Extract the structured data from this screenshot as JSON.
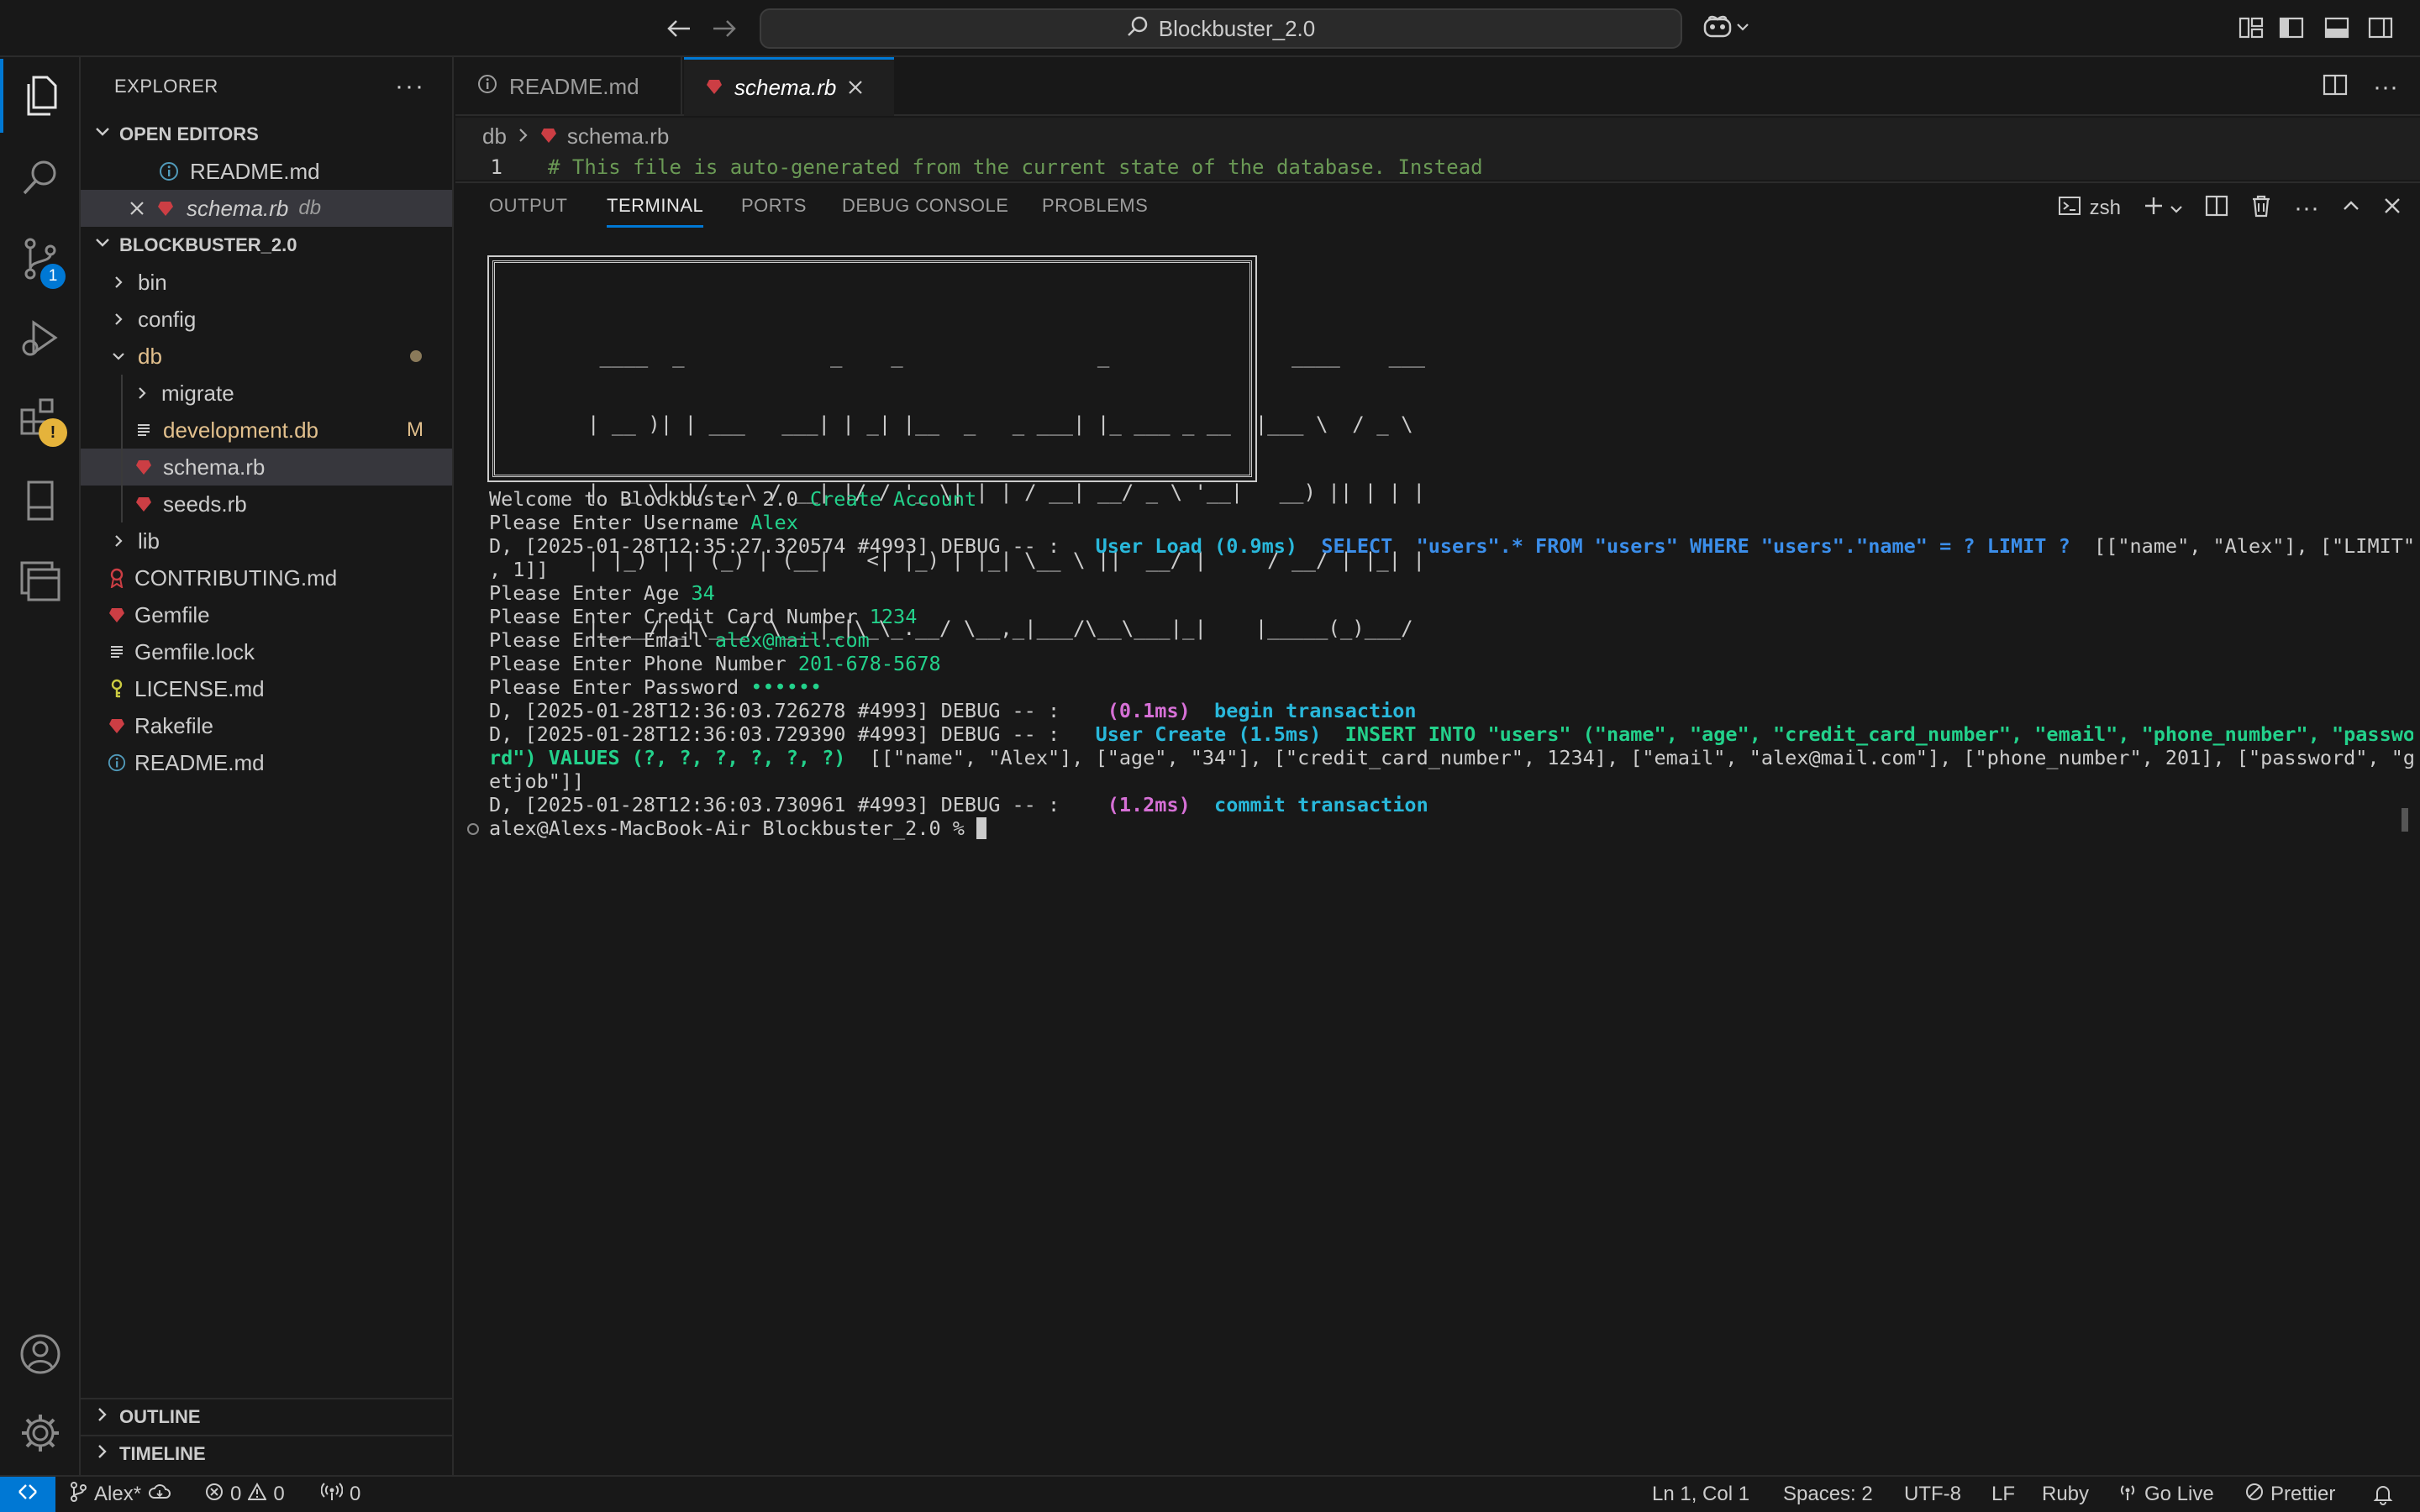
{
  "titlebar": {
    "search_text": "Blockbuster_2.0"
  },
  "activity": {
    "scm_badge": "1"
  },
  "sidebar": {
    "title": "EXPLORER",
    "open_editors_title": "OPEN EDITORS",
    "open_editors": [
      {
        "name": "README.md"
      },
      {
        "name": "schema.rb",
        "desc": "db"
      }
    ],
    "project_title": "BLOCKBUSTER_2.0",
    "tree": {
      "bin": "bin",
      "config": "config",
      "db": "db",
      "migrate": "migrate",
      "development_db": "development.db",
      "development_db_status": "M",
      "schema": "schema.rb",
      "seeds": "seeds.rb",
      "lib": "lib",
      "contributing": "CONTRIBUTING.md",
      "gemfile": "Gemfile",
      "gemfile_lock": "Gemfile.lock",
      "license": "LICENSE.md",
      "rakefile": "Rakefile",
      "readme": "README.md"
    },
    "outline": "OUTLINE",
    "timeline": "TIMELINE"
  },
  "editor": {
    "tabs": [
      {
        "label": "README.md"
      },
      {
        "label": "schema.rb"
      }
    ],
    "breadcrumb": [
      "db",
      "schema.rb"
    ],
    "line_number": "1",
    "line_text": "# This file is auto-generated from the current state of the database. Instead"
  },
  "panel": {
    "tabs": [
      "OUTPUT",
      "TERMINAL",
      "PORTS",
      "DEBUG CONSOLE",
      "PROBLEMS"
    ],
    "shell": "zsh"
  },
  "terminal": {
    "ascii_art": [
      " ____  _            _    _                _               ____    ___  ",
      "| __ )| | ___   ___| | _| |__  _   _ ___| |_ ___ _ __  |___ \\  / _ \\ ",
      "|  _ \\| |/ _ \\ / __| |/ / '_ \\| | | / __| __/ _ \\ '__|   __) || | | |",
      "| |_) | | (_) | (__|   <| |_) | |_| \\__ \\ ||  __/ |     / __/ | |_| |",
      "|____/|_|\\___/ \\___|_|\\_\\_.__/ \\__,_|___/\\__\\___|_|    |_____(_)___/ "
    ],
    "welcome": "Welcome to Blockbuster 2.0 ",
    "welcome_action": "Create Account",
    "username_prompt": "Please Enter Username ",
    "username_value": "Alex",
    "debug1_prefix": "D, [2025-01-28T12:35:27.320574 #4993] DEBUG -- :   ",
    "debug1_load": "User Load (0.9ms)",
    "debug1_sql": "  SELECT  \"users\".* FROM \"users\" WHERE \"users\".\"name\" = ? LIMIT ?",
    "debug1_binds": "  [[\"name\", \"Alex\"], [\"LIMIT\"",
    "debug1_wrap": ", 1]]",
    "age_prompt": "Please Enter Age ",
    "age_value": "34",
    "cc_prompt": "Please Enter Credit Card Number ",
    "cc_value": "1234",
    "email_prompt": "Please Enter Email ",
    "email_value": "alex@mail.com",
    "phone_prompt": "Please Enter Phone Number ",
    "phone_value": "201-678-5678",
    "password_prompt": "Please Enter Password ",
    "password_value": "••••••",
    "debug2_prefix": "D, [2025-01-28T12:36:03.726278 #4993] DEBUG -- :    ",
    "debug2_time": "(0.1ms)",
    "debug2_sql": "  begin transaction",
    "debug3_prefix": "D, [2025-01-28T12:36:03.729390 #4993] DEBUG -- :   ",
    "debug3_create": "User Create (1.5ms)",
    "debug3_sql": "  INSERT INTO \"users\" (\"name\", \"age\", \"credit_card_number\", \"email\", \"phone_number\", \"passwo",
    "debug3_sql_wrap": "rd\") VALUES (?, ?, ?, ?, ?, ?)",
    "debug3_binds": "  [[\"name\", \"Alex\"], [\"age\", \"34\"], [\"credit_card_number\", 1234], [\"email\", \"alex@mail.com\"], [\"phone_number\", 201], [\"password\", \"g",
    "debug3_binds_wrap": "etjob\"]]",
    "debug4_prefix": "D, [2025-01-28T12:36:03.730961 #4993] DEBUG -- :    ",
    "debug4_time": "(1.2ms)",
    "debug4_sql": "  commit transaction",
    "prompt": "alex@Alexs-MacBook-Air Blockbuster_2.0 % "
  },
  "statusbar": {
    "branch": "Alex*",
    "errors": "0",
    "warnings": "0",
    "ports": "0",
    "position": "Ln 1, Col 1",
    "spaces": "Spaces: 2",
    "encoding": "UTF-8",
    "eol": "LF",
    "language": "Ruby",
    "golive": "Go Live",
    "prettier": "Prettier"
  },
  "colors": {
    "accent": "#0078d4",
    "ruby": "#cc3e44",
    "modified": "#e2c08d",
    "terminal_green": "#23d18b",
    "terminal_cyan": "#29b8db",
    "terminal_blue": "#3b8eea",
    "terminal_magenta": "#d670d6"
  }
}
